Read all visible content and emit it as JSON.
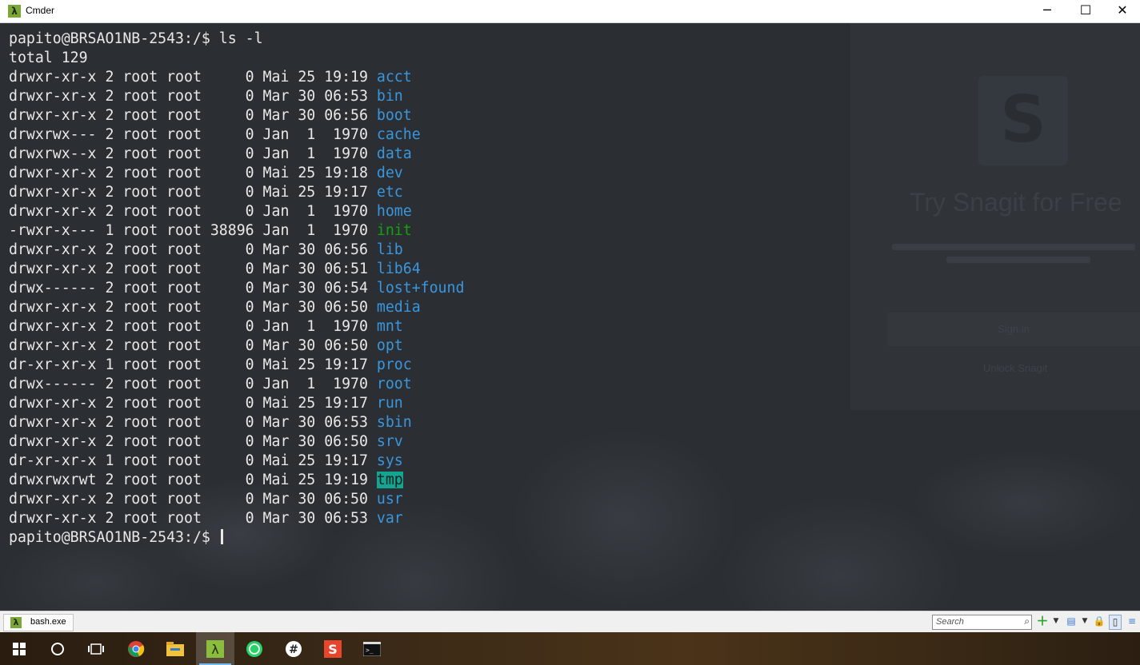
{
  "window": {
    "title": "Cmder",
    "minimize": "─",
    "maximize": "☐",
    "close": "✕"
  },
  "terminal": {
    "lines": [
      {
        "text": "papito@BRSAO1NB-2543:/$ ls -l"
      },
      {
        "text": "total 129"
      },
      {
        "meta": "drwxr-xr-x 2 root root     0 Mai 25 19:19 ",
        "name": "acct",
        "kind": "dir"
      },
      {
        "meta": "drwxr-xr-x 2 root root     0 Mar 30 06:53 ",
        "name": "bin",
        "kind": "dir"
      },
      {
        "meta": "drwxr-xr-x 2 root root     0 Mar 30 06:56 ",
        "name": "boot",
        "kind": "dir"
      },
      {
        "meta": "drwxrwx--- 2 root root     0 Jan  1  1970 ",
        "name": "cache",
        "kind": "dir"
      },
      {
        "meta": "drwxrwx--x 2 root root     0 Jan  1  1970 ",
        "name": "data",
        "kind": "dir"
      },
      {
        "meta": "drwxr-xr-x 2 root root     0 Mai 25 19:18 ",
        "name": "dev",
        "kind": "dir"
      },
      {
        "meta": "drwxr-xr-x 2 root root     0 Mai 25 19:17 ",
        "name": "etc",
        "kind": "dir"
      },
      {
        "meta": "drwxr-xr-x 2 root root     0 Jan  1  1970 ",
        "name": "home",
        "kind": "dir"
      },
      {
        "meta": "-rwxr-x--- 1 root root 38896 Jan  1  1970 ",
        "name": "init",
        "kind": "exec"
      },
      {
        "meta": "drwxr-xr-x 2 root root     0 Mar 30 06:56 ",
        "name": "lib",
        "kind": "dir"
      },
      {
        "meta": "drwxr-xr-x 2 root root     0 Mar 30 06:51 ",
        "name": "lib64",
        "kind": "dir"
      },
      {
        "meta": "drwx------ 2 root root     0 Mar 30 06:54 ",
        "name": "lost+found",
        "kind": "dir"
      },
      {
        "meta": "drwxr-xr-x 2 root root     0 Mar 30 06:50 ",
        "name": "media",
        "kind": "dir"
      },
      {
        "meta": "drwxr-xr-x 2 root root     0 Jan  1  1970 ",
        "name": "mnt",
        "kind": "dir"
      },
      {
        "meta": "drwxr-xr-x 2 root root     0 Mar 30 06:50 ",
        "name": "opt",
        "kind": "dir"
      },
      {
        "meta": "dr-xr-xr-x 1 root root     0 Mai 25 19:17 ",
        "name": "proc",
        "kind": "dir"
      },
      {
        "meta": "drwx------ 2 root root     0 Jan  1  1970 ",
        "name": "root",
        "kind": "dir"
      },
      {
        "meta": "drwxr-xr-x 2 root root     0 Mai 25 19:17 ",
        "name": "run",
        "kind": "dir"
      },
      {
        "meta": "drwxr-xr-x 2 root root     0 Mar 30 06:53 ",
        "name": "sbin",
        "kind": "dir"
      },
      {
        "meta": "drwxr-xr-x 2 root root     0 Mar 30 06:50 ",
        "name": "srv",
        "kind": "dir"
      },
      {
        "meta": "dr-xr-xr-x 1 root root     0 Mai 25 19:17 ",
        "name": "sys",
        "kind": "dir"
      },
      {
        "meta": "drwxrwxrwt 2 root root     0 Mai 25 19:19 ",
        "name": "tmp",
        "kind": "sticky"
      },
      {
        "meta": "drwxr-xr-x 2 root root     0 Mar 30 06:50 ",
        "name": "usr",
        "kind": "dir"
      },
      {
        "meta": "drwxr-xr-x 2 root root     0 Mar 30 06:53 ",
        "name": "var",
        "kind": "dir"
      }
    ],
    "prompt": "papito@BRSAO1NB-2543:/$ "
  },
  "background_panel": {
    "title": "Try Snagit for Free",
    "signin_label": "Sign in",
    "unlock_label": "Unlock Snagit",
    "logo_letter": "S"
  },
  "statusbar": {
    "tab_label": "bash.exe",
    "search_placeholder": "Search"
  },
  "taskbar": {
    "items": [
      "start-button",
      "search-button",
      "task-view",
      "chrome",
      "file-explorer",
      "cmder",
      "whatsapp",
      "slack",
      "snagit",
      "console"
    ]
  },
  "colors": {
    "terminal_bg": "#2b2f33",
    "dir": "#3a96dd",
    "exec": "#13a10e",
    "sticky_bg": "#12a592",
    "text": "#e8e8e8"
  }
}
